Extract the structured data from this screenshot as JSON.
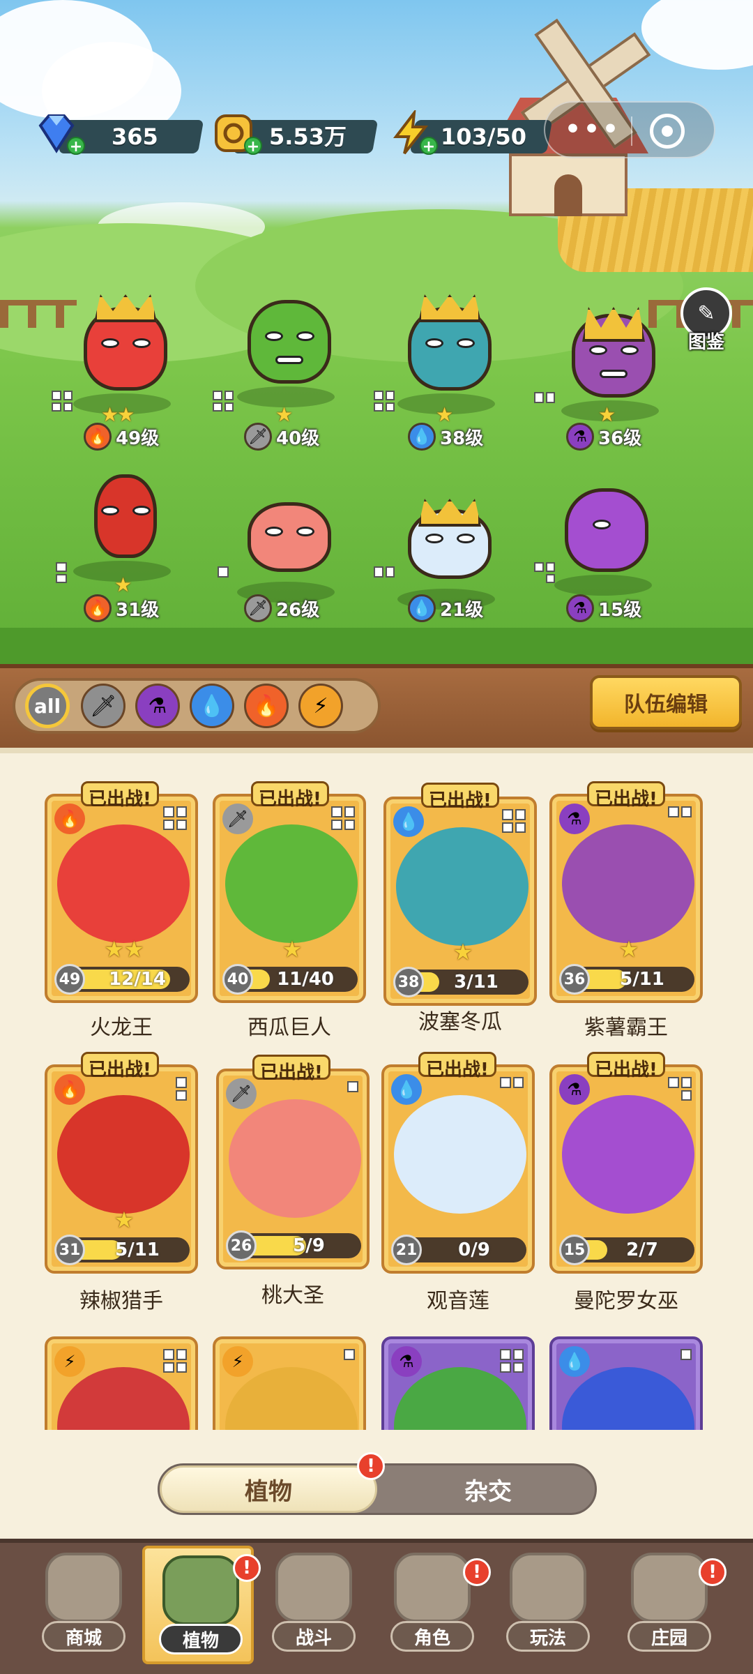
{
  "resources": {
    "gems": {
      "value": "365",
      "icon": "diamond-icon"
    },
    "gold": {
      "value": "5.53万",
      "icon": "coin-icon"
    },
    "energy": {
      "value": "103/50",
      "icon": "lightning-icon"
    }
  },
  "capsule": {
    "more": "•••",
    "close": "◎"
  },
  "atlas": {
    "label": "图鉴"
  },
  "field_plants": [
    {
      "level": "49级",
      "element": "fire",
      "stars": "★★"
    },
    {
      "level": "40级",
      "element": "sword",
      "stars": "★"
    },
    {
      "level": "38级",
      "element": "water",
      "stars": "★"
    },
    {
      "level": "36级",
      "element": "poison",
      "stars": "★"
    },
    {
      "level": "31级",
      "element": "fire",
      "stars": "★"
    },
    {
      "level": "26级",
      "element": "sword",
      "stars": ""
    },
    {
      "level": "21级",
      "element": "water",
      "stars": ""
    },
    {
      "level": "15级",
      "element": "poison",
      "stars": ""
    }
  ],
  "filters": {
    "all": "all",
    "items": [
      "sword",
      "poison",
      "water",
      "fire",
      "lightning"
    ]
  },
  "team_edit": "队伍编辑",
  "deployed_label": "已出战!",
  "cards": [
    {
      "name": "火龙王",
      "level": "49",
      "progress": "12/14",
      "fill": 0.86,
      "element": "fire",
      "stars": "★★"
    },
    {
      "name": "西瓜巨人",
      "level": "40",
      "progress": "11/40",
      "fill": 0.28,
      "element": "sword",
      "stars": "★"
    },
    {
      "name": "波塞冬瓜",
      "level": "38",
      "progress": "3/11",
      "fill": 0.27,
      "element": "water",
      "stars": "★"
    },
    {
      "name": "紫薯霸王",
      "level": "36",
      "progress": "5/11",
      "fill": 0.45,
      "element": "poison",
      "stars": "★"
    },
    {
      "name": "辣椒猎手",
      "level": "31",
      "progress": "5/11",
      "fill": 0.45,
      "element": "fire",
      "stars": "★"
    },
    {
      "name": "桃大圣",
      "level": "26",
      "progress": "5/9",
      "fill": 0.56,
      "element": "sword",
      "stars": ""
    },
    {
      "name": "观音莲",
      "level": "21",
      "progress": "0/9",
      "fill": 0.0,
      "element": "water",
      "stars": ""
    },
    {
      "name": "曼陀罗女巫",
      "level": "15",
      "progress": "2/7",
      "fill": 0.29,
      "element": "poison",
      "stars": ""
    }
  ],
  "partial_cards": [
    {
      "element": "lightning"
    },
    {
      "element": "lightning"
    },
    {
      "element": "poison"
    },
    {
      "element": "water"
    }
  ],
  "toggle": {
    "plants": "植物",
    "hybrid": "杂交",
    "badge": "!"
  },
  "nav": [
    {
      "label": "商城",
      "icon": "shop-icon",
      "badge": ""
    },
    {
      "label": "植物",
      "icon": "plants-icon",
      "badge": "!"
    },
    {
      "label": "战斗",
      "icon": "battle-icon",
      "badge": ""
    },
    {
      "label": "角色",
      "icon": "character-icon",
      "badge": "!"
    },
    {
      "label": "玩法",
      "icon": "gameplay-icon",
      "badge": ""
    },
    {
      "label": "庄园",
      "icon": "manor-icon",
      "badge": "!"
    }
  ],
  "colors": {
    "fire": "#f0622a",
    "sword": "#9a9a9a",
    "water": "#3b8de8",
    "poison": "#8a3fc0",
    "lightning": "#f2a22a"
  }
}
